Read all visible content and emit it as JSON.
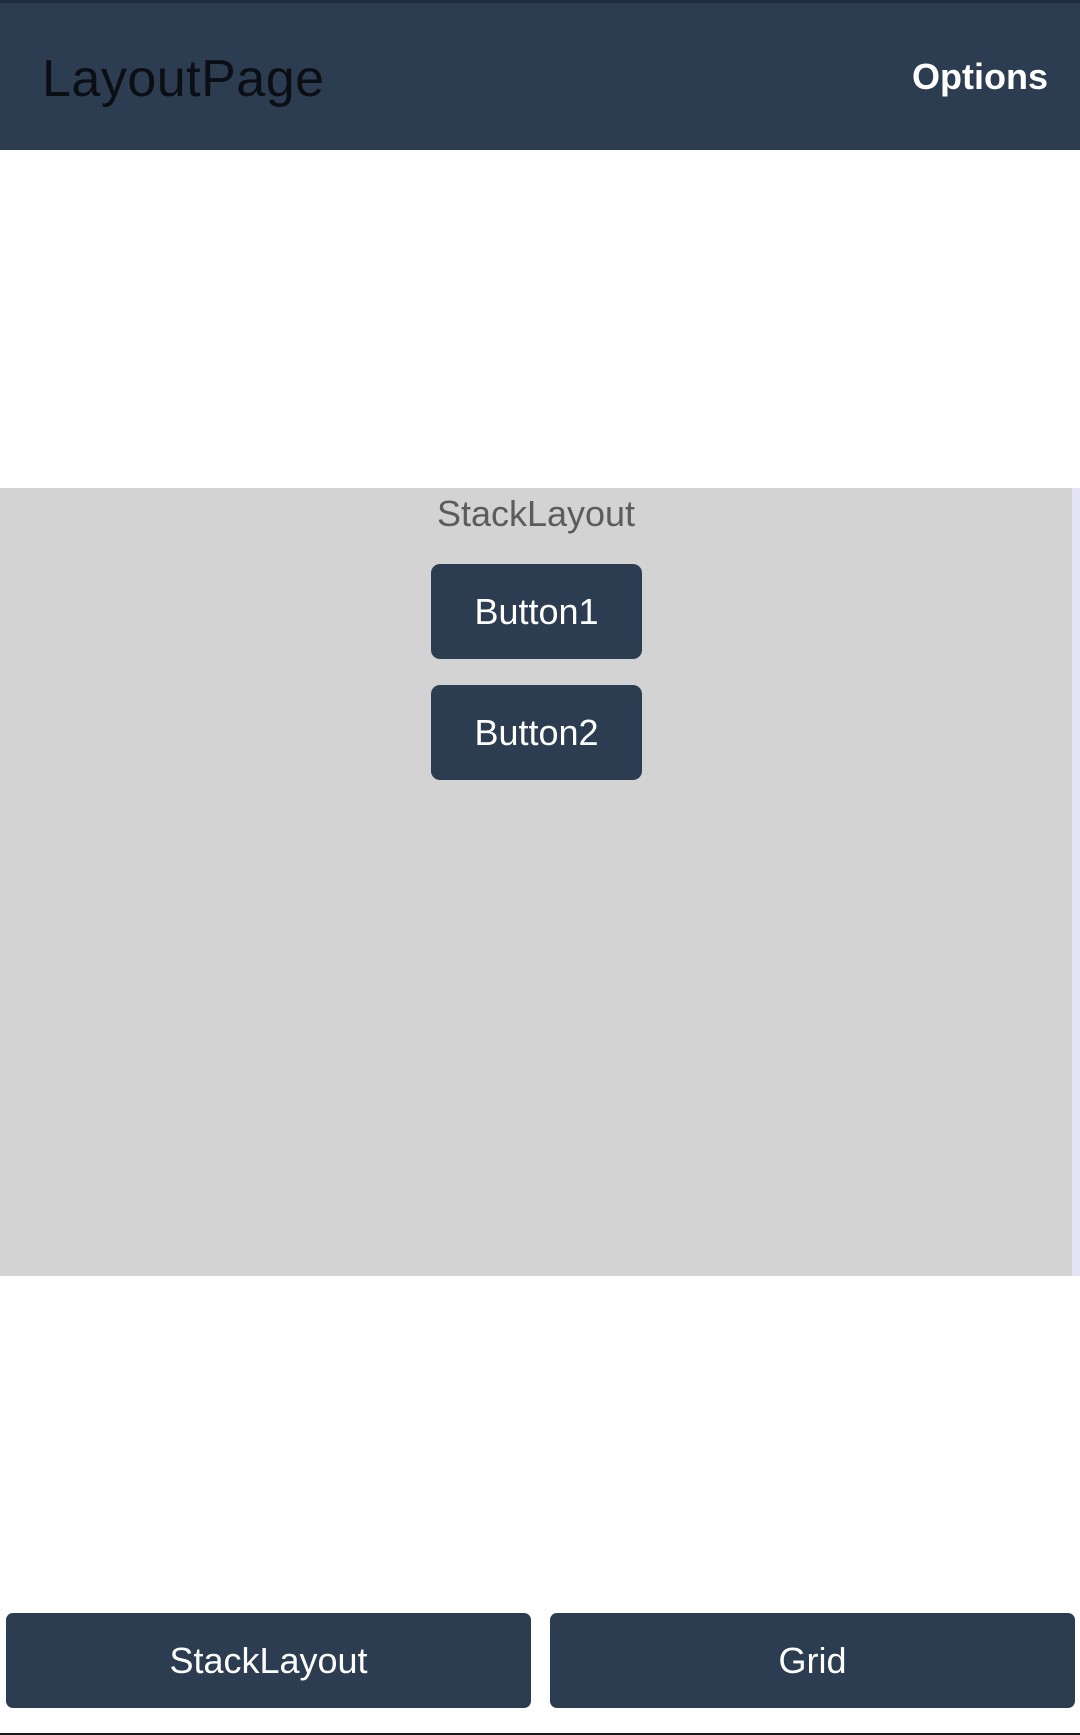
{
  "app_bar": {
    "title": "LayoutPage",
    "options_label": "Options",
    "background": "#2d3d51"
  },
  "stack_panel": {
    "label": "StackLayout",
    "background": "#d3d3d3",
    "buttons": [
      {
        "label": "Button1"
      },
      {
        "label": "Button2"
      }
    ]
  },
  "bottom_bar": {
    "buttons": [
      {
        "label": "StackLayout"
      },
      {
        "label": "Grid"
      }
    ]
  },
  "colors": {
    "accent": "#2d3d51",
    "button_text": "#ffffff"
  }
}
